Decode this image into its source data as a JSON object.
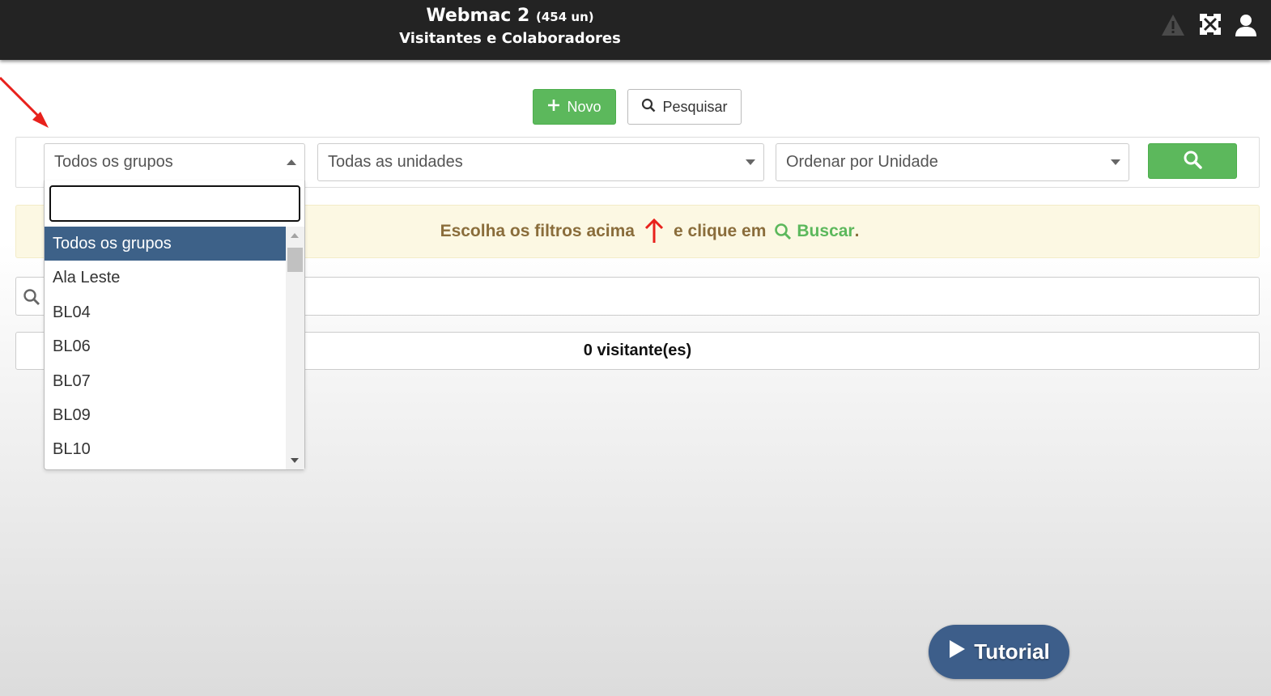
{
  "header": {
    "app_title": "Webmac 2",
    "app_count": "(454 un)",
    "subtitle": "Visitantes e Colaboradores",
    "icons": [
      "warning-icon",
      "expand-icon",
      "user-icon"
    ]
  },
  "toolbar": {
    "novo_label": "Novo",
    "pesquisar_label": "Pesquisar"
  },
  "filters": {
    "grupos_value": "Todos os grupos",
    "unidades_value": "Todas as unidades",
    "ordenar_value": "Ordenar por Unidade"
  },
  "dropdown": {
    "search_value": "",
    "items": [
      {
        "label": "Todos os grupos",
        "selected": true
      },
      {
        "label": "Ala Leste",
        "selected": false
      },
      {
        "label": "BL04",
        "selected": false
      },
      {
        "label": "BL06",
        "selected": false
      },
      {
        "label": "BL07",
        "selected": false
      },
      {
        "label": "BL09",
        "selected": false
      },
      {
        "label": "BL10",
        "selected": false
      }
    ]
  },
  "alert": {
    "text_before": "Escolha os filtros acima",
    "text_middle": "e clique em",
    "action_word": "Buscar",
    "period": "."
  },
  "search": {
    "placeholder": ""
  },
  "results": {
    "count_text": "0 visitante(es)"
  },
  "tutorial": {
    "label": "Tutorial"
  },
  "colors": {
    "header_bg": "#232323",
    "success": "#5cb85c",
    "alert_text": "#8a6d3b",
    "alert_bg": "#fcf8e3",
    "selected_item_bg": "#3d6188",
    "tutorial_bg": "#3d5e8a",
    "annotation_red": "#e8211c"
  }
}
